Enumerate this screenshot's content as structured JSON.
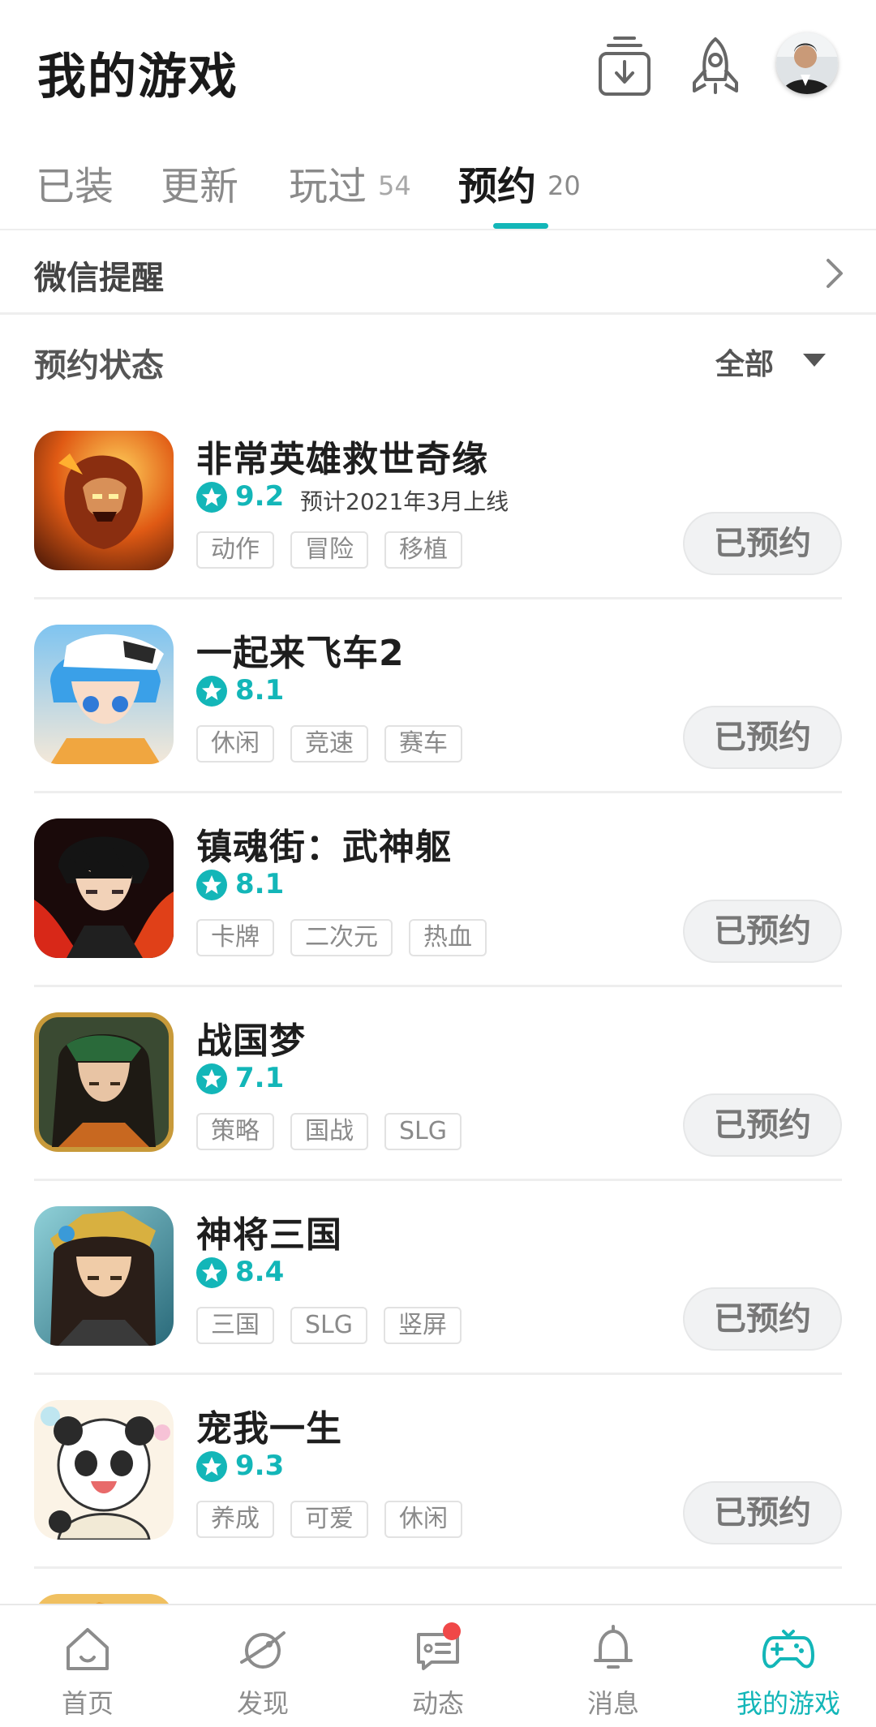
{
  "header": {
    "title": "我的游戏"
  },
  "tabs": [
    {
      "label": "已装",
      "count": ""
    },
    {
      "label": "更新",
      "count": ""
    },
    {
      "label": "玩过",
      "count": "54"
    },
    {
      "label": "预约",
      "count": "20",
      "active": true
    }
  ],
  "wechat": {
    "label": "微信提醒"
  },
  "status": {
    "label": "预约状态",
    "filter": "全部"
  },
  "games": [
    {
      "name": "非常英雄救世奇缘",
      "score": "9.2",
      "release": "预计2021年3月上线",
      "tags": [
        "动作",
        "冒险",
        "移植"
      ],
      "button": "已预约"
    },
    {
      "name": "一起来飞车2",
      "score": "8.1",
      "release": "",
      "tags": [
        "休闲",
        "竞速",
        "赛车"
      ],
      "button": "已预约"
    },
    {
      "name": "镇魂街：武神躯",
      "score": "8.1",
      "release": "",
      "tags": [
        "卡牌",
        "二次元",
        "热血"
      ],
      "button": "已预约"
    },
    {
      "name": "战国梦",
      "score": "7.1",
      "release": "",
      "tags": [
        "策略",
        "国战",
        "SLG"
      ],
      "button": "已预约"
    },
    {
      "name": "神将三国",
      "score": "8.4",
      "release": "",
      "tags": [
        "三国",
        "SLG",
        "竖屏"
      ],
      "button": "已预约"
    },
    {
      "name": "宠我一生",
      "score": "9.3",
      "release": "",
      "tags": [
        "养成",
        "可爱",
        "休闲"
      ],
      "button": "已预约"
    }
  ],
  "nav": [
    {
      "label": "首页",
      "icon": "home-icon"
    },
    {
      "label": "发现",
      "icon": "discover-icon"
    },
    {
      "label": "动态",
      "icon": "feed-icon"
    },
    {
      "label": "消息",
      "icon": "bell-icon"
    },
    {
      "label": "我的游戏",
      "icon": "gamepad-icon",
      "active": true
    }
  ],
  "colors": {
    "accent": "#13b6b8",
    "badge": "#f04848",
    "button_bg": "#f1f2f3",
    "tag_border": "#e2e2e2"
  }
}
